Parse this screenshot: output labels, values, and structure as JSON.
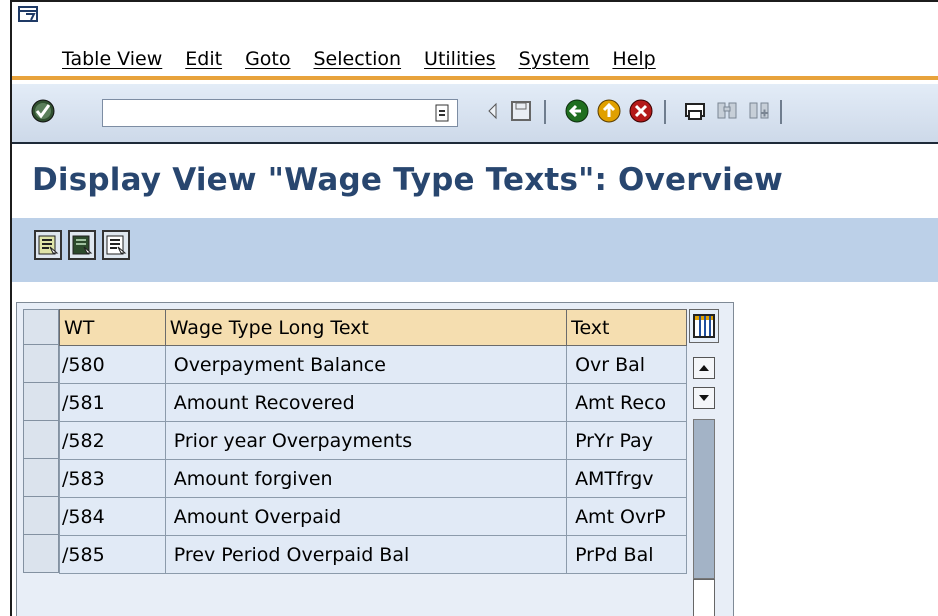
{
  "menubar": {
    "items": [
      "Table View",
      "Edit",
      "Goto",
      "Selection",
      "Utilities",
      "System",
      "Help"
    ]
  },
  "toolbar": {
    "command_value": "",
    "icons": [
      "enter-icon",
      "command-dropdown-icon",
      "back-arrow-icon",
      "save-icon",
      "back-icon",
      "exit-icon",
      "cancel-icon",
      "print-icon",
      "find-icon",
      "find-next-icon"
    ]
  },
  "page": {
    "title": "Display View \"Wage Type Texts\": Overview"
  },
  "app_toolbar": {
    "buttons": [
      "select-all-icon",
      "select-block-icon",
      "deselect-all-icon"
    ]
  },
  "table": {
    "columns": [
      "WT",
      "Wage Type Long Text",
      "Text"
    ],
    "rows": [
      {
        "wt": "/580",
        "long": "Overpayment Balance",
        "text": "Ovr Bal"
      },
      {
        "wt": "/581",
        "long": "Amount Recovered",
        "text": "Amt Reco"
      },
      {
        "wt": "/582",
        "long": "Prior year Overpayments",
        "text": "PrYr Pay"
      },
      {
        "wt": "/583",
        "long": "Amount forgiven",
        "text": "AMTfrgv"
      },
      {
        "wt": "/584",
        "long": "Amount Overpaid",
        "text": "Amt OvrP"
      },
      {
        "wt": "/585",
        "long": "Prev Period Overpaid Bal",
        "text": "PrPd Bal"
      }
    ]
  },
  "colors": {
    "accent_orange": "#e8a33c",
    "title_blue": "#28466f",
    "header_tan": "#f5deb0",
    "cell_blue": "#e1eaf6",
    "app_toolbar_blue": "#bcd0e8"
  }
}
